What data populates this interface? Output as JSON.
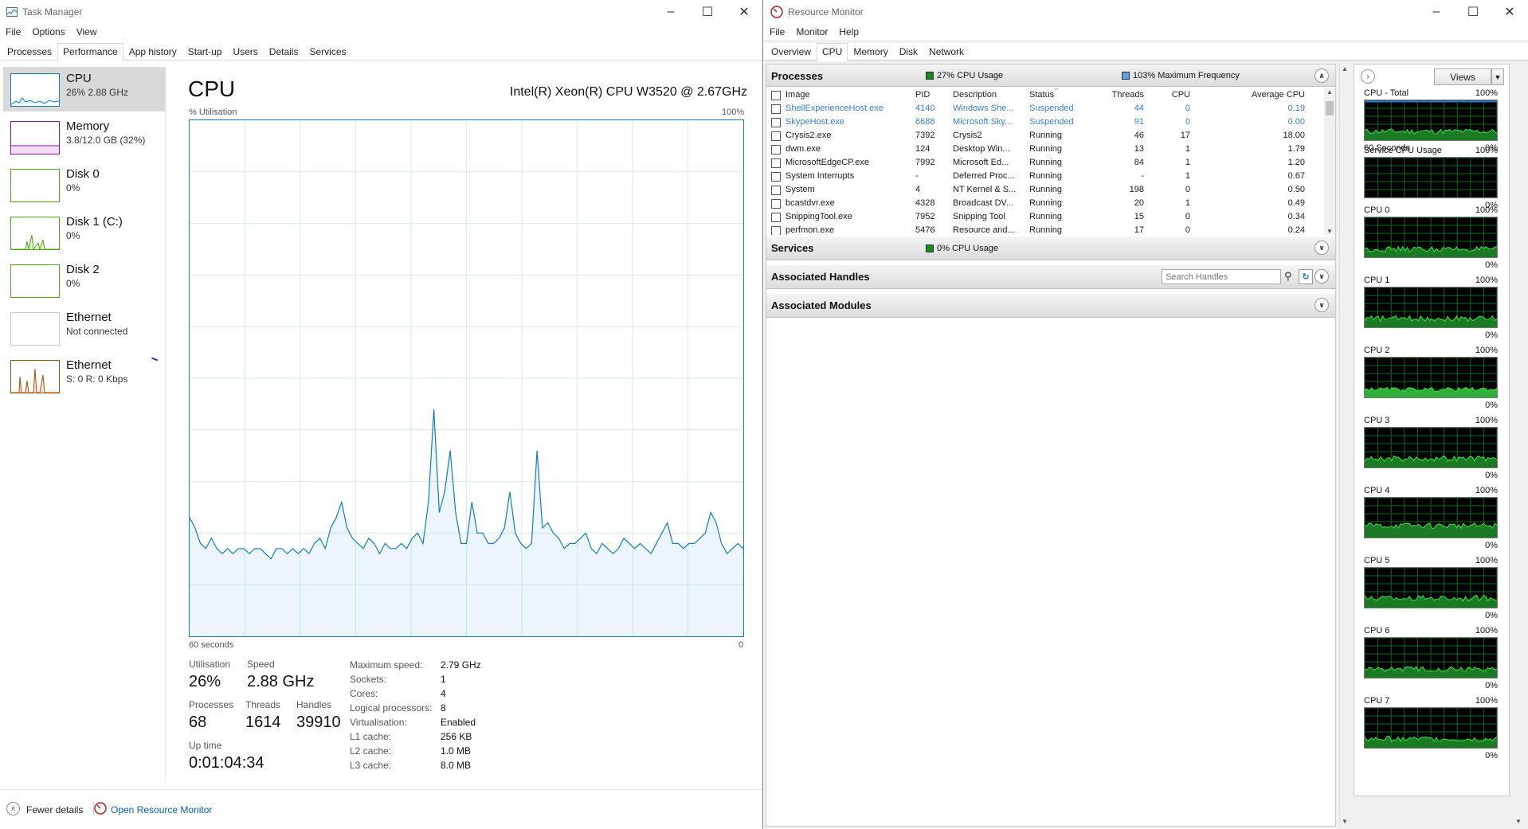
{
  "task_manager": {
    "title": "Task Manager",
    "menu": [
      "File",
      "Options",
      "View"
    ],
    "tabs": [
      "Processes",
      "Performance",
      "App history",
      "Start-up",
      "Users",
      "Details",
      "Services"
    ],
    "active_tab": "Performance",
    "sidebar": [
      {
        "name": "CPU",
        "sub": "26% 2.88 GHz",
        "color": "#117dbb",
        "selected": true
      },
      {
        "name": "Memory",
        "sub": "3.8/12.0 GB (32%)",
        "color": "#8b12ae"
      },
      {
        "name": "Disk 0",
        "sub": "0%",
        "color": "#4da60c"
      },
      {
        "name": "Disk 1 (C:)",
        "sub": "0%",
        "color": "#4da60c"
      },
      {
        "name": "Disk 2",
        "sub": "0%",
        "color": "#4da60c"
      },
      {
        "name": "Ethernet",
        "sub": "Not connected",
        "color": "#cccccc"
      },
      {
        "name": "Ethernet",
        "sub": "S: 0 R: 0 Kbps",
        "color": "#a74f01"
      }
    ],
    "main": {
      "title": "CPU",
      "model": "Intel(R) Xeon(R) CPU W3520 @ 2.67GHz",
      "graph_label": "% Utilisation",
      "graph_max": "100%",
      "graph_time": "60 seconds",
      "graph_min": "0",
      "graph_color": "#117dbb",
      "utilization_series": [
        23,
        21,
        18,
        17,
        19,
        17,
        16,
        17,
        16,
        17,
        17,
        16,
        17,
        17,
        16,
        15,
        17,
        17,
        16,
        17,
        16,
        17,
        16,
        18,
        19,
        17,
        21,
        23,
        26,
        21,
        19,
        18,
        17,
        19,
        18,
        16,
        18,
        17,
        17,
        18,
        17,
        19,
        20,
        18,
        26,
        44,
        24,
        28,
        36,
        24,
        18,
        18,
        26,
        20,
        20,
        18,
        18,
        19,
        21,
        28,
        20,
        18,
        17,
        18,
        36,
        21,
        22,
        20,
        19,
        17,
        18,
        18,
        19,
        20,
        17,
        16,
        18,
        17,
        16,
        17,
        19,
        18,
        17,
        18,
        17,
        16,
        18,
        20,
        22,
        18,
        18,
        17,
        18,
        18,
        19,
        20,
        24,
        22,
        18,
        16,
        17,
        18,
        17
      ],
      "stats": [
        {
          "label": "Utilisation",
          "value": "26%"
        },
        {
          "label": "Speed",
          "value": "2.88 GHz"
        },
        {
          "label": "Processes",
          "value": "68"
        },
        {
          "label": "Threads",
          "value": "1614"
        },
        {
          "label": "Handles",
          "value": "39910"
        },
        {
          "label": "Up time",
          "value": "0:01:04:34"
        }
      ],
      "specs": [
        {
          "k": "Maximum speed:",
          "v": "2.79 GHz"
        },
        {
          "k": "Sockets:",
          "v": "1"
        },
        {
          "k": "Cores:",
          "v": "4"
        },
        {
          "k": "Logical processors:",
          "v": "8"
        },
        {
          "k": "Virtualisation:",
          "v": "Enabled"
        },
        {
          "k": "L1 cache:",
          "v": "256 KB"
        },
        {
          "k": "L2 cache:",
          "v": "1.0 MB"
        },
        {
          "k": "L3 cache:",
          "v": "8.0 MB"
        }
      ]
    },
    "footer": {
      "fewer": "Fewer details",
      "open_rm": "Open Resource Monitor"
    }
  },
  "resource_monitor": {
    "title": "Resource Monitor",
    "menu": [
      "File",
      "Monitor",
      "Help"
    ],
    "tabs": [
      "Overview",
      "CPU",
      "Memory",
      "Disk",
      "Network"
    ],
    "active_tab": "CPU",
    "processes": {
      "label": "Processes",
      "cpu_usage": "27% CPU Usage",
      "max_freq": "103% Maximum Frequency",
      "columns": [
        "Image",
        "PID",
        "Description",
        "Status",
        "Threads",
        "CPU",
        "Average CPU"
      ],
      "rows": [
        [
          "ShellExperienceHost.exe",
          "4140",
          "Windows She...",
          "Suspended",
          "44",
          "0",
          "0.19"
        ],
        [
          "SkypeHost.exe",
          "6688",
          "Microsoft Sky...",
          "Suspended",
          "91",
          "0",
          "0.00"
        ],
        [
          "Crysis2.exe",
          "7392",
          "Crysis2",
          "Running",
          "46",
          "17",
          "18.00"
        ],
        [
          "dwm.exe",
          "124",
          "Desktop Win...",
          "Running",
          "13",
          "1",
          "1.79"
        ],
        [
          "MicrosoftEdgeCP.exe",
          "7992",
          "Microsoft Ed...",
          "Running",
          "84",
          "1",
          "1.20"
        ],
        [
          "System Interrupts",
          "-",
          "Deferred Proc...",
          "Running",
          "-",
          "1",
          "0.67"
        ],
        [
          "System",
          "4",
          "NT Kernel & S...",
          "Running",
          "198",
          "0",
          "0.50"
        ],
        [
          "bcastdvr.exe",
          "4328",
          "Broadcast DV...",
          "Running",
          "20",
          "1",
          "0.49"
        ],
        [
          "SnippingTool.exe",
          "7952",
          "Snipping Tool",
          "Running",
          "15",
          "0",
          "0.34"
        ],
        [
          "perfmon.exe",
          "5476",
          "Resource and...",
          "Running",
          "17",
          "0",
          "0.24"
        ]
      ]
    },
    "services": {
      "label": "Services",
      "cpu_usage": "0% CPU Usage"
    },
    "handles": {
      "label": "Associated Handles",
      "search_placeholder": "Search Handles"
    },
    "modules": {
      "label": "Associated Modules"
    },
    "views_label": "Views",
    "graphs": [
      {
        "title": "CPU - Total",
        "max": "100%",
        "min": "0%",
        "footer_left": "60 Seconds"
      },
      {
        "title": "Service CPU Usage",
        "max": "100%",
        "min": "0%"
      },
      {
        "title": "CPU 0",
        "max": "100%",
        "min": "0%"
      },
      {
        "title": "CPU 1",
        "max": "100%",
        "min": "0%"
      },
      {
        "title": "CPU 2",
        "max": "100%",
        "min": "0%"
      },
      {
        "title": "CPU 3",
        "max": "100%",
        "min": "0%"
      },
      {
        "title": "CPU 4",
        "max": "100%",
        "min": "0%"
      },
      {
        "title": "CPU 5",
        "max": "100%",
        "min": "0%"
      },
      {
        "title": "CPU 6",
        "max": "100%",
        "min": "0%"
      },
      {
        "title": "CPU 7",
        "max": "100%",
        "min": "0%"
      }
    ]
  }
}
